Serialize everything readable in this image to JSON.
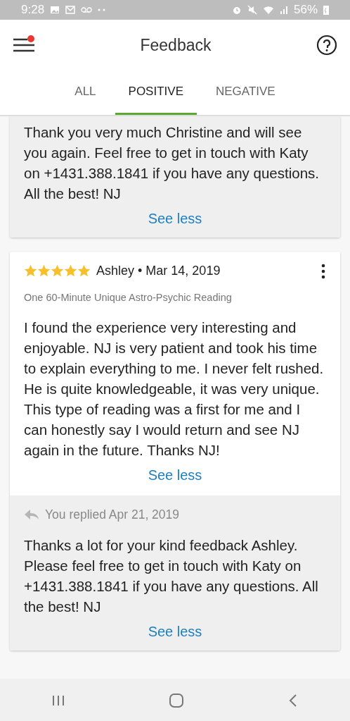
{
  "status_bar": {
    "time": "9:28",
    "battery": "56%"
  },
  "header": {
    "title": "Feedback",
    "menu_notification": true
  },
  "tabs": [
    {
      "label": "ALL",
      "selected": false
    },
    {
      "label": "POSITIVE",
      "selected": true
    },
    {
      "label": "NEGATIVE",
      "selected": false
    }
  ],
  "feedback": [
    {
      "reply": {
        "text": "Thank you very much Christine and will see you again. Feel free to get in touch with Katy on +1431.388.1841 if you have any questions. All the best! NJ",
        "link": "See less"
      }
    },
    {
      "stars": 5,
      "byline": "Ashley • Mar 14, 2019",
      "product": "One 60-Minute Unique Astro-Psychic Reading",
      "text": "I found the experience very interesting and enjoyable. NJ is very patient and took his time to explain everything to me. I never felt rushed. He is quite knowledgeable, it was very unique. This type of reading was a first for me and I can honestly say I would return and see NJ again in the future. Thanks NJ!",
      "link": "See less",
      "reply": {
        "label": "You replied Apr 21, 2019",
        "text": "Thanks a lot for your kind feedback Ashley. Please feel free to get in touch with Katy on +1431.388.1841 if you have any questions. All the best! NJ",
        "link": "See less"
      }
    }
  ]
}
